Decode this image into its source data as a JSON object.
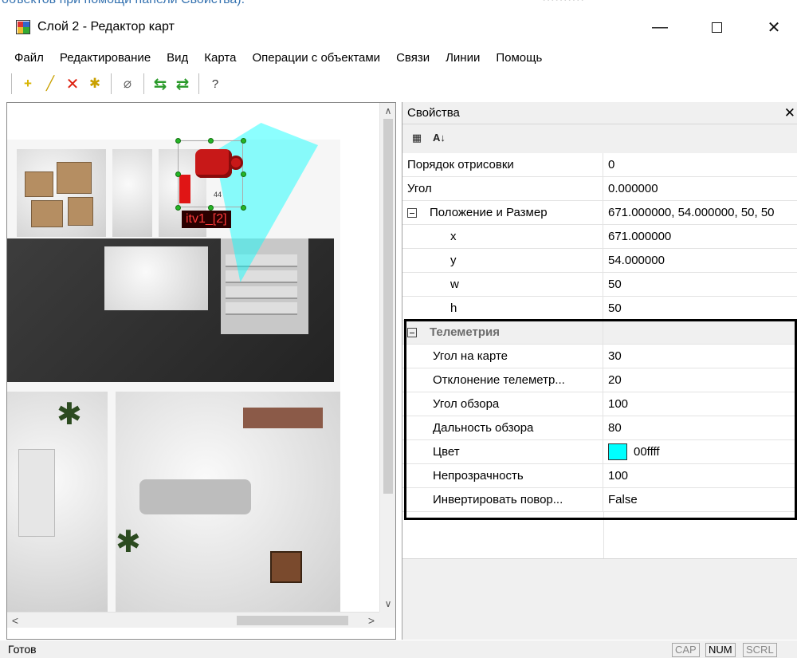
{
  "top_fragment": {
    "link_text": "объектов при помощи панели Свойства).",
    "gray_text": "··········"
  },
  "window": {
    "title": "Слой 2 - Редактор карт",
    "minimize": "—",
    "close": "✕"
  },
  "menu": [
    "Файл",
    "Редактирование",
    "Вид",
    "Карта",
    "Операции с объектами",
    "Связи",
    "Линии",
    "Помощь"
  ],
  "toolbar": {
    "add": "+",
    "line": "╱",
    "delete": "✕",
    "modify": "✱",
    "erase": "⌀",
    "undo": "⇆",
    "redo": "⇄",
    "help": "?"
  },
  "map": {
    "camera_label": "itv1_[2]",
    "camera_number": "44",
    "scroll_up": "∧",
    "scroll_down": "∨",
    "scroll_left": "<",
    "scroll_right": ">",
    "fov_color": "#00ffff",
    "camera_color": "#c81818"
  },
  "properties": {
    "title": "Свойства",
    "close": "✕",
    "sort_categorized_icon": "categorized-icon",
    "sort_alpha_icon": "sort-az-icon",
    "rows": [
      {
        "name": "Порядок отрисовки",
        "value": "0"
      },
      {
        "name": "Угол",
        "value": "0.000000"
      },
      {
        "name": "Положение и Размер",
        "value": "671.000000, 54.000000, 50, 50"
      },
      {
        "name": "x",
        "value": "671.000000"
      },
      {
        "name": "y",
        "value": "54.000000"
      },
      {
        "name": "w",
        "value": "50"
      },
      {
        "name": "h",
        "value": "50"
      }
    ],
    "telemetry": {
      "group": "Телеметрия",
      "rows": [
        {
          "name": "Угол на карте",
          "value": "30"
        },
        {
          "name": "Отклонение телеметр...",
          "value": "20"
        },
        {
          "name": "Угол обзора",
          "value": "100"
        },
        {
          "name": "Дальность обзора",
          "value": "80"
        },
        {
          "name": "Цвет",
          "value": "00ffff",
          "color": "#00ffff"
        },
        {
          "name": "Непрозрачность",
          "value": "100"
        },
        {
          "name": "Инвертировать повор...",
          "value": "False"
        }
      ]
    }
  },
  "status": {
    "text": "Готов",
    "cap": "CAP",
    "num": "NUM",
    "scrl": "SCRL"
  }
}
